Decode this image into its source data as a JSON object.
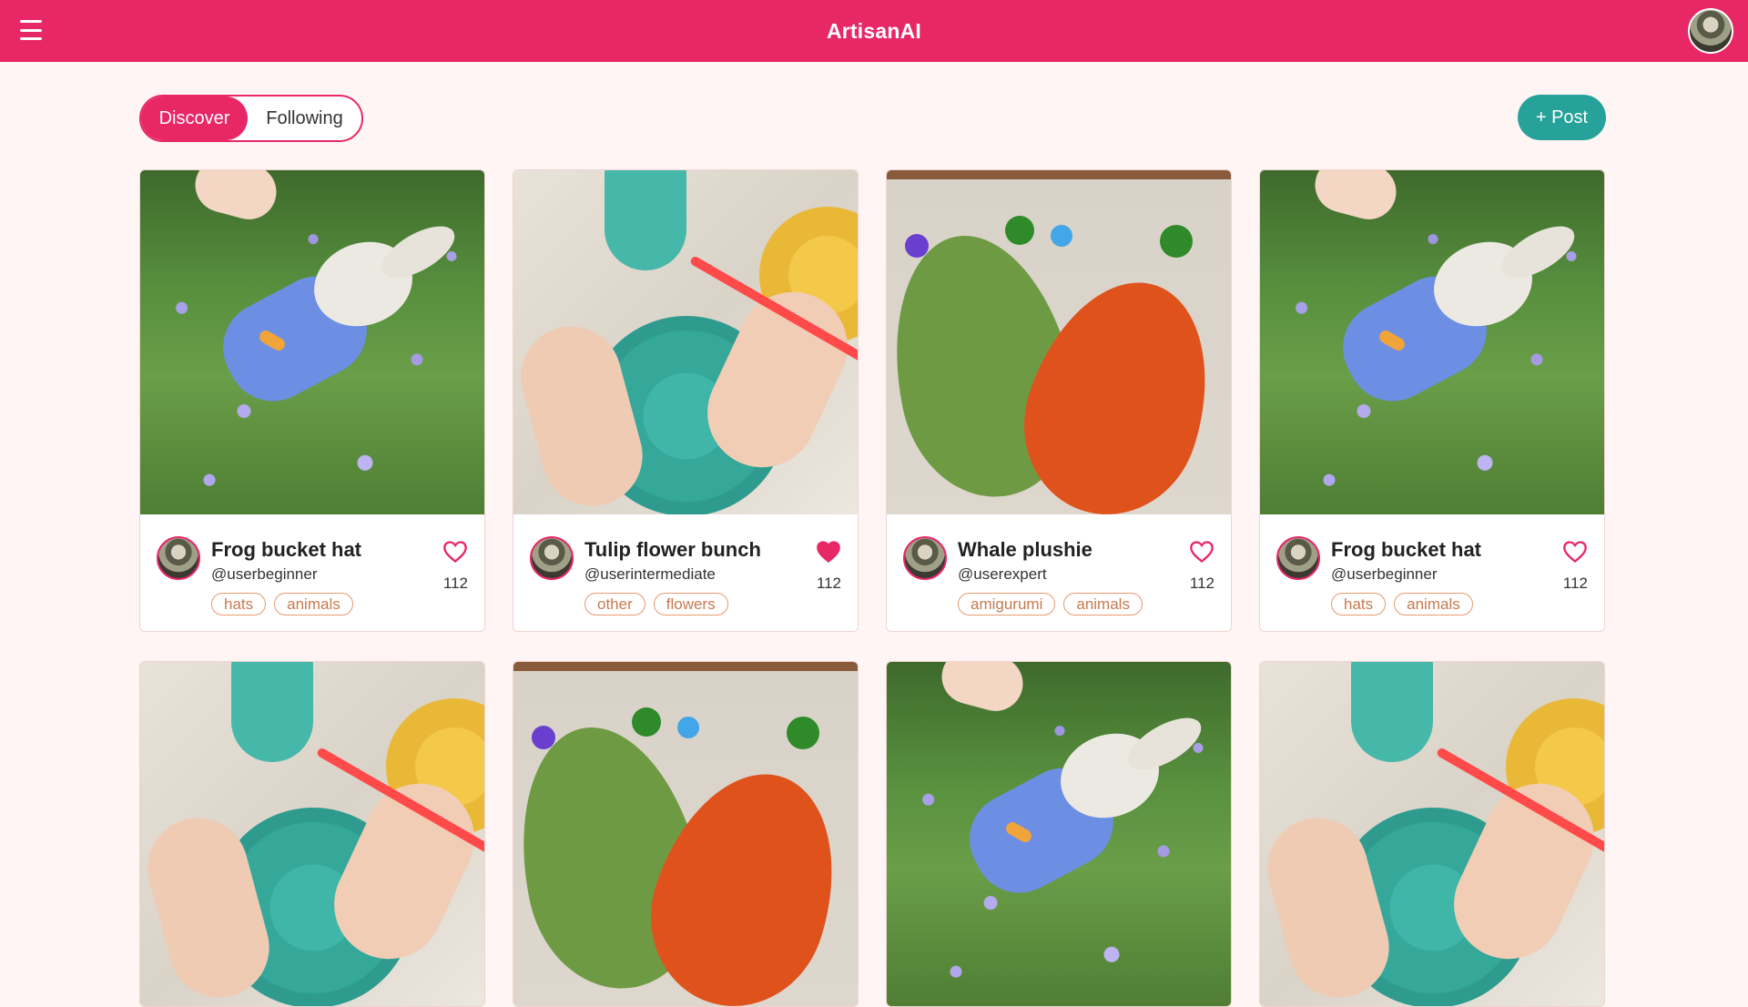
{
  "app": {
    "title": "ArtisanAI"
  },
  "tabs": {
    "active": "Discover",
    "inactive": "Following"
  },
  "actions": {
    "post_label": "+ Post"
  },
  "cards": [
    {
      "title": "Frog bucket hat",
      "user": "@userbeginner",
      "tags": [
        "hats",
        "animals"
      ],
      "likes": "112",
      "liked": false,
      "image": "bunny"
    },
    {
      "title": "Tulip flower bunch",
      "user": "@userintermediate",
      "tags": [
        "other",
        "flowers"
      ],
      "likes": "112",
      "liked": true,
      "image": "crochet"
    },
    {
      "title": "Whale plushie",
      "user": "@userexpert",
      "tags": [
        "amigurumi",
        "animals"
      ],
      "likes": "112",
      "liked": false,
      "image": "leaf"
    },
    {
      "title": "Frog bucket hat",
      "user": "@userbeginner",
      "tags": [
        "hats",
        "animals"
      ],
      "likes": "112",
      "liked": false,
      "image": "bunny"
    }
  ],
  "colors": {
    "brand": "#e82766",
    "accent": "#26a29a",
    "tag": "#e79a6e",
    "background": "#fff5f4"
  }
}
